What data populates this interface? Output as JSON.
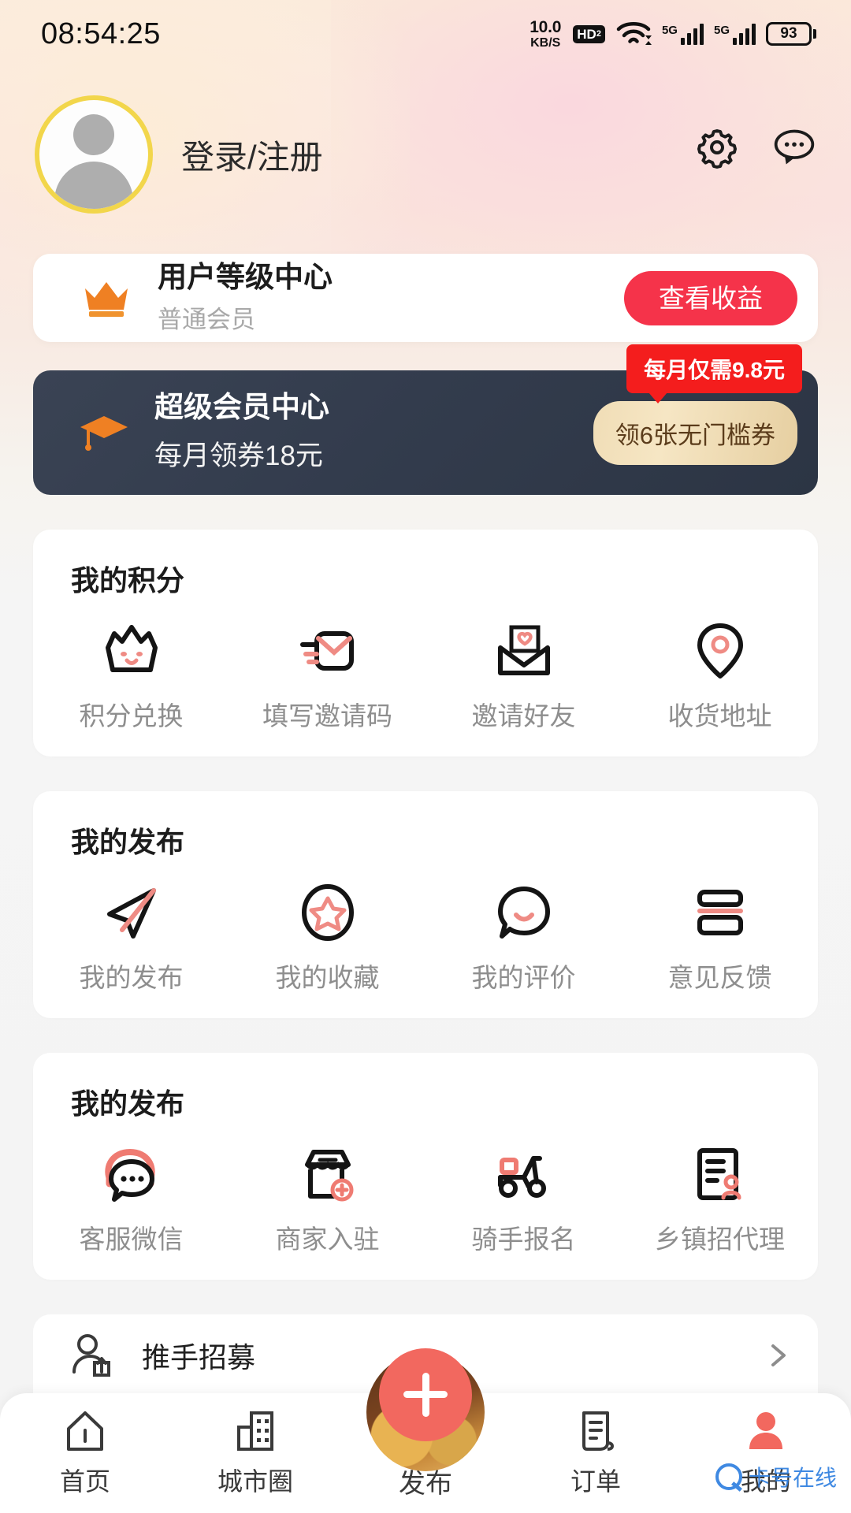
{
  "statusbar": {
    "time": "08:54:25",
    "net_speed_value": "10.0",
    "net_speed_unit": "KB/S",
    "hd_label": "HD",
    "hd_sub": "2",
    "signal1_label": "5G",
    "signal2_label": "5G",
    "battery_level": "93",
    "icons": [
      "wifi-icon",
      "signal-icon",
      "battery-icon"
    ]
  },
  "header": {
    "login_label": "登录/注册",
    "avatar_icon": "default-avatar-icon",
    "settings_icon": "gear-icon",
    "message_icon": "chat-bubble-icon"
  },
  "level_card": {
    "icon": "crown-icon",
    "title": "用户等级中心",
    "subtitle": "普通会员",
    "button_label": "查看收益",
    "button_color": "#f5334a"
  },
  "vip_card": {
    "icon": "graduation-cap-icon",
    "title": "超级会员中心",
    "subtitle": "每月领券18元",
    "badge_label": "每月仅需9.8元",
    "badge_color": "#f41d1d",
    "coupon_label": "领6张无门槛券",
    "bg_color": "#333c4d"
  },
  "sections": [
    {
      "title": "我的积分",
      "items": [
        {
          "icon": "crown-face-icon",
          "label": "积分兑换"
        },
        {
          "icon": "invite-code-mail-icon",
          "label": "填写邀请码"
        },
        {
          "icon": "heart-envelope-icon",
          "label": "邀请好友"
        },
        {
          "icon": "location-pin-icon",
          "label": "收货地址"
        }
      ]
    },
    {
      "title": "我的发布",
      "items": [
        {
          "icon": "paper-plane-icon",
          "label": "我的发布"
        },
        {
          "icon": "star-circle-icon",
          "label": "我的收藏"
        },
        {
          "icon": "comment-smile-icon",
          "label": "我的评价"
        },
        {
          "icon": "feedback-layers-icon",
          "label": "意见反馈"
        }
      ]
    },
    {
      "title": "我的发布",
      "items": [
        {
          "icon": "headset-chat-icon",
          "label": "客服微信"
        },
        {
          "icon": "shop-plus-icon",
          "label": "商家入驻"
        },
        {
          "icon": "scooter-icon",
          "label": "骑手报名"
        },
        {
          "icon": "document-agent-icon",
          "label": "乡镇招代理"
        }
      ]
    }
  ],
  "recruit": {
    "icon": "person-share-icon",
    "label": "推手招募",
    "chevron": "chevron-right-icon"
  },
  "tabbar": {
    "items": [
      {
        "icon": "home-icon",
        "label": "首页",
        "active": false
      },
      {
        "icon": "city-icon",
        "label": "城市圈",
        "active": false
      },
      {
        "icon": "plus-icon",
        "label": "发布",
        "active": false
      },
      {
        "icon": "order-icon",
        "label": "订单",
        "active": false
      },
      {
        "icon": "profile-icon",
        "label": "我的",
        "active": true
      }
    ],
    "fab_color": "#f2685f",
    "active_color": "#f2685f"
  },
  "watermark": {
    "text": "卡号在线"
  }
}
